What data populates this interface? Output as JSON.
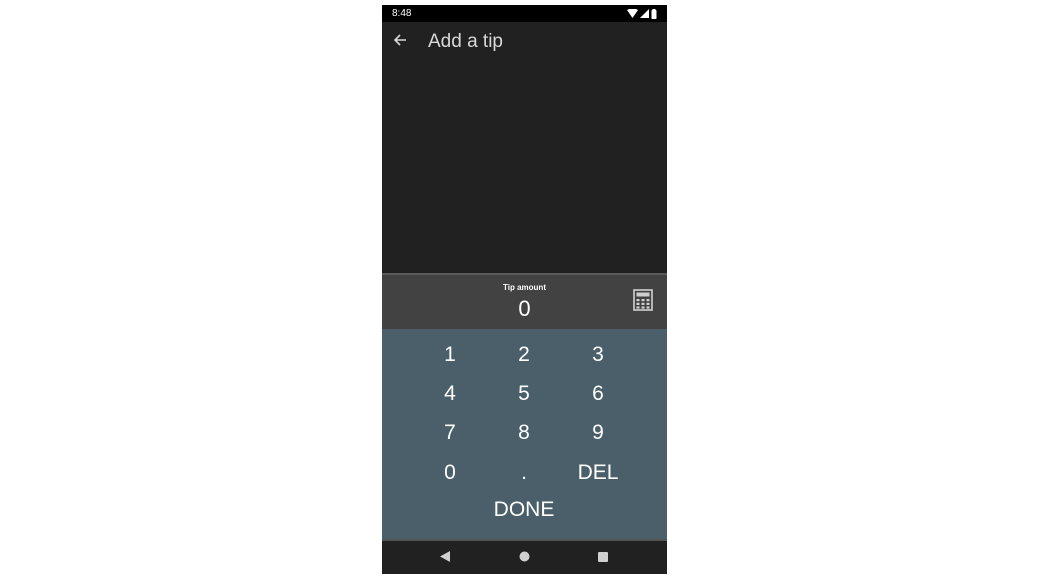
{
  "status_bar": {
    "time": "8:48",
    "icons": [
      "wifi-icon",
      "signal-icon",
      "battery-icon"
    ]
  },
  "app_bar": {
    "back_icon": "arrow-back-icon",
    "title": "Add a tip"
  },
  "tip_panel": {
    "label": "Tip amount",
    "value": "0",
    "calculator_icon": "calculator-icon"
  },
  "keypad": {
    "keys": [
      "1",
      "2",
      "3",
      "4",
      "5",
      "6",
      "7",
      "8",
      "9",
      "0",
      ".",
      "DEL"
    ],
    "done_label": "DONE"
  },
  "nav_bar": {
    "buttons": [
      "back-triangle-icon",
      "home-circle-icon",
      "recents-square-icon"
    ]
  },
  "colors": {
    "background": "#212121",
    "keypad": "#4a5f6a",
    "tip_panel": "#424242",
    "text": "#ffffff"
  }
}
